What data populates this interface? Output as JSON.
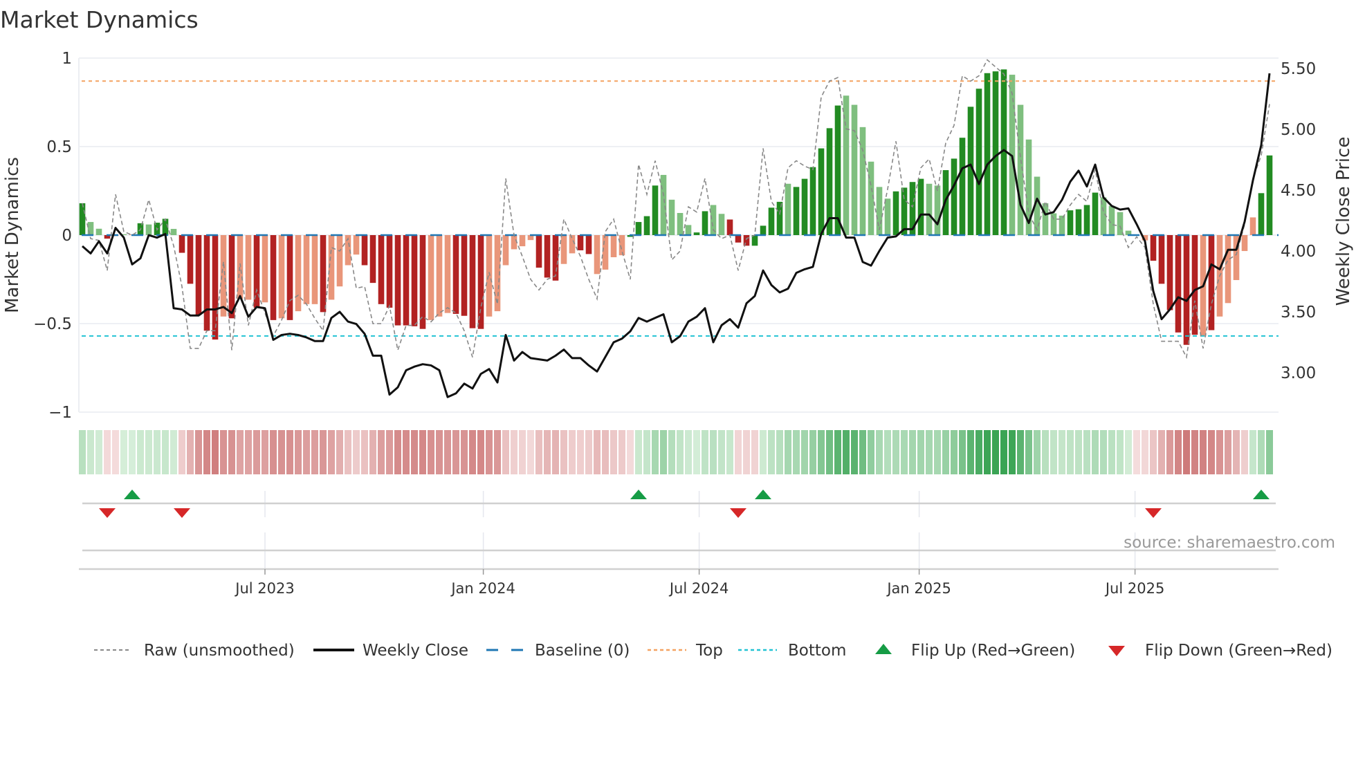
{
  "chart_data": {
    "type": "bar",
    "title": "Market Dynamics",
    "ylabel": "Market Dynamics",
    "y2label": "Weekly Close Price",
    "ylim": [
      -1,
      1
    ],
    "y2lim": [
      2.6,
      5.6
    ],
    "yticks": [
      {
        "v": 1,
        "label": "1"
      },
      {
        "v": 0.5,
        "label": "0.5"
      },
      {
        "v": 0,
        "label": "0"
      },
      {
        "v": -0.5,
        "label": "−0.5"
      },
      {
        "v": -1,
        "label": "−1"
      }
    ],
    "y2ticks": [
      {
        "v": 5.5,
        "label": "5.50"
      },
      {
        "v": 5.0,
        "label": "5.00"
      },
      {
        "v": 4.5,
        "label": "4.50"
      },
      {
        "v": 4.0,
        "label": "4.00"
      },
      {
        "v": 3.5,
        "label": "3.50"
      },
      {
        "v": 3.0,
        "label": "3.00"
      }
    ],
    "xticks": [
      {
        "week": 22,
        "label": "Jul 2023"
      },
      {
        "week": 48.3,
        "label": "Jan 2024"
      },
      {
        "week": 74.3,
        "label": "Jul 2024"
      },
      {
        "week": 100.8,
        "label": "Jan 2025"
      },
      {
        "week": 126.8,
        "label": "Jul 2025"
      }
    ],
    "frequency": "weekly",
    "top_level": 0.87,
    "bottom_level": -0.57,
    "baseline": 0,
    "grid": true,
    "legend_position": "bottom",
    "dynamics": [
      0.18,
      0.074,
      0.036,
      -0.02,
      -0.005,
      0.005,
      0.003,
      0.067,
      0.06,
      0.07,
      0.092,
      0.035,
      -0.1,
      -0.275,
      -0.45,
      -0.54,
      -0.59,
      -0.46,
      -0.47,
      -0.36,
      -0.365,
      -0.41,
      -0.38,
      -0.48,
      -0.47,
      -0.48,
      -0.43,
      -0.39,
      -0.39,
      -0.435,
      -0.365,
      -0.29,
      -0.17,
      -0.11,
      -0.17,
      -0.27,
      -0.39,
      -0.41,
      -0.51,
      -0.51,
      -0.515,
      -0.53,
      -0.48,
      -0.46,
      -0.44,
      -0.445,
      -0.456,
      -0.526,
      -0.53,
      -0.46,
      -0.43,
      -0.17,
      -0.08,
      -0.063,
      -0.028,
      -0.184,
      -0.24,
      -0.257,
      -0.163,
      -0.103,
      -0.086,
      -0.107,
      -0.22,
      -0.195,
      -0.125,
      -0.114,
      -0.01,
      0.074,
      0.107,
      0.28,
      0.34,
      0.2,
      0.125,
      0.057,
      0.015,
      0.135,
      0.17,
      0.12,
      0.088,
      -0.042,
      -0.06,
      -0.06,
      0.053,
      0.155,
      0.188,
      0.29,
      0.272,
      0.318,
      0.384,
      0.49,
      0.604,
      0.732,
      0.788,
      0.736,
      0.61,
      0.415,
      0.272,
      0.206,
      0.247,
      0.268,
      0.3,
      0.318,
      0.29,
      0.28,
      0.367,
      0.432,
      0.55,
      0.725,
      0.827,
      0.915,
      0.925,
      0.936,
      0.906,
      0.736,
      0.54,
      0.33,
      0.18,
      0.123,
      0.11,
      0.14,
      0.146,
      0.17,
      0.24,
      0.213,
      0.165,
      0.13,
      0.025,
      -0.003,
      -0.03,
      -0.145,
      -0.275,
      -0.424,
      -0.55,
      -0.62,
      -0.563,
      -0.572,
      -0.537,
      -0.46,
      -0.384,
      -0.254,
      -0.09,
      0.1,
      0.237,
      0.45
    ],
    "states": "GggRrgrGgGGgRRRRRrRrrRrRrRrrrRrrrrRRRRRRRRrrrRRRRrrrrrrRRRrrRRrrrrGGGGggggGGggRRRGGGGgGGGGGGggggggGGGGggGGGGGGGGgggggggGGGGgggggrRRRRRRrRrrrrrGGG",
    "raw": [
      0.18,
      -0.02,
      -0.03,
      -0.2,
      0.23,
      0.02,
      0.0,
      0.03,
      0.2,
      0.03,
      0.09,
      -0.06,
      -0.29,
      -0.64,
      -0.64,
      -0.54,
      -0.54,
      -0.15,
      -0.65,
      -0.16,
      -0.51,
      -0.31,
      -0.44,
      -0.57,
      -0.48,
      -0.37,
      -0.34,
      -0.39,
      -0.47,
      -0.54,
      -0.07,
      -0.09,
      -0.02,
      -0.3,
      -0.29,
      -0.5,
      -0.5,
      -0.4,
      -0.65,
      -0.51,
      -0.51,
      -0.46,
      -0.49,
      -0.44,
      -0.41,
      -0.44,
      -0.54,
      -0.69,
      -0.41,
      -0.21,
      -0.39,
      0.32,
      0.0,
      -0.12,
      -0.25,
      -0.31,
      -0.25,
      -0.23,
      0.09,
      -0.02,
      -0.12,
      -0.25,
      -0.36,
      0.02,
      0.09,
      -0.09,
      -0.25,
      0.4,
      0.23,
      0.42,
      0.23,
      -0.14,
      -0.09,
      0.16,
      0.13,
      0.32,
      0.03,
      -0.02,
      0.0,
      -0.2,
      -0.02,
      0.0,
      0.49,
      0.19,
      0.12,
      0.38,
      0.42,
      0.39,
      0.37,
      0.78,
      0.87,
      0.89,
      0.6,
      0.59,
      0.48,
      0.28,
      0.03,
      0.26,
      0.53,
      0.2,
      0.16,
      0.38,
      0.43,
      0.25,
      0.52,
      0.62,
      0.9,
      0.87,
      0.9,
      0.99,
      0.95,
      0.91,
      0.8,
      0.44,
      0.12,
      0.03,
      0.19,
      0.09,
      0.09,
      0.17,
      0.23,
      0.19,
      0.37,
      0.13,
      0.06,
      0.05,
      -0.07,
      -0.01,
      -0.07,
      -0.39,
      -0.6,
      -0.6,
      -0.6,
      -0.69,
      -0.37,
      -0.64,
      -0.39,
      -0.23,
      -0.14,
      -0.11,
      0.06,
      0.32,
      0.45,
      0.74
    ],
    "close": [
      4.04,
      3.98,
      4.08,
      3.98,
      4.19,
      4.11,
      3.89,
      3.94,
      4.13,
      4.11,
      4.14,
      3.53,
      3.52,
      3.47,
      3.47,
      3.52,
      3.52,
      3.54,
      3.49,
      3.63,
      3.46,
      3.54,
      3.53,
      3.27,
      3.31,
      3.32,
      3.31,
      3.29,
      3.26,
      3.26,
      3.45,
      3.5,
      3.42,
      3.4,
      3.32,
      3.14,
      3.14,
      2.82,
      2.88,
      3.02,
      3.05,
      3.07,
      3.06,
      3.02,
      2.8,
      2.83,
      2.91,
      2.87,
      2.99,
      3.03,
      2.92,
      3.31,
      3.1,
      3.17,
      3.12,
      3.11,
      3.1,
      3.14,
      3.19,
      3.12,
      3.12,
      3.06,
      3.01,
      3.13,
      3.25,
      3.28,
      3.34,
      3.45,
      3.42,
      3.45,
      3.48,
      3.25,
      3.3,
      3.42,
      3.46,
      3.53,
      3.25,
      3.39,
      3.44,
      3.37,
      3.57,
      3.63,
      3.84,
      3.72,
      3.66,
      3.69,
      3.82,
      3.85,
      3.87,
      4.14,
      4.27,
      4.27,
      4.11,
      4.11,
      3.91,
      3.88,
      4.0,
      4.11,
      4.12,
      4.18,
      4.18,
      4.3,
      4.3,
      4.22,
      4.42,
      4.54,
      4.68,
      4.71,
      4.55,
      4.71,
      4.78,
      4.83,
      4.78,
      4.38,
      4.23,
      4.43,
      4.3,
      4.32,
      4.42,
      4.57,
      4.66,
      4.53,
      4.71,
      4.44,
      4.37,
      4.34,
      4.35,
      4.22,
      4.08,
      3.67,
      3.44,
      3.52,
      3.62,
      3.59,
      3.68,
      3.71,
      3.89,
      3.85,
      4.01,
      4.01,
      4.24,
      4.58,
      4.87,
      5.46
    ],
    "flip_up_weeks": [
      6,
      67,
      82,
      142
    ],
    "flip_down_weeks": [
      3,
      12,
      79,
      129
    ],
    "colors": {
      "strong_up": "#228b22",
      "weak_up": "#7fbf7f",
      "strong_down": "#b22222",
      "weak_down": "#e9967a",
      "baseline": "#1f77b4",
      "top": "#f4a261",
      "bottom": "#22c3d3",
      "raw": "#888888",
      "close": "#111111",
      "flip_up": "#169c45",
      "flip_down": "#d62728"
    },
    "legend": [
      {
        "key": "raw",
        "label": "Raw (unsmoothed)"
      },
      {
        "key": "close",
        "label": "Weekly Close"
      },
      {
        "key": "baseline",
        "label": "Baseline (0)"
      },
      {
        "key": "top",
        "label": "Top"
      },
      {
        "key": "bottom",
        "label": "Bottom"
      },
      {
        "key": "flip_up",
        "label": "Flip Up (Red→Green)"
      },
      {
        "key": "flip_down",
        "label": "Flip Down (Green→Red)"
      }
    ],
    "source": "source: sharemaestro.com"
  }
}
